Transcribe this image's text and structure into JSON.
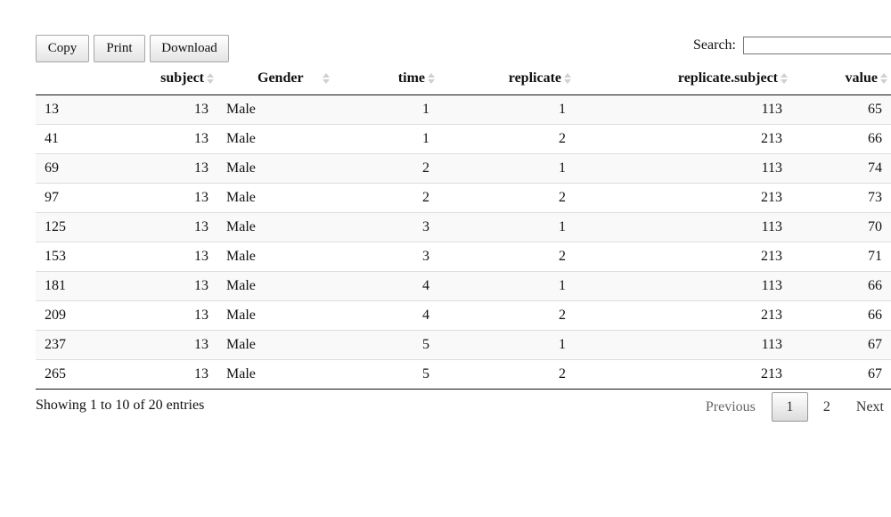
{
  "toolbar": {
    "copy_label": "Copy",
    "print_label": "Print",
    "download_label": "Download"
  },
  "search": {
    "label": "Search:",
    "value": ""
  },
  "table": {
    "columns": [
      "",
      "subject",
      "Gender",
      "time",
      "replicate",
      "replicate.subject",
      "value"
    ],
    "rows": [
      [
        "13",
        "13",
        "Male",
        "1",
        "1",
        "113",
        "65"
      ],
      [
        "41",
        "13",
        "Male",
        "1",
        "2",
        "213",
        "66"
      ],
      [
        "69",
        "13",
        "Male",
        "2",
        "1",
        "113",
        "74"
      ],
      [
        "97",
        "13",
        "Male",
        "2",
        "2",
        "213",
        "73"
      ],
      [
        "125",
        "13",
        "Male",
        "3",
        "1",
        "113",
        "70"
      ],
      [
        "153",
        "13",
        "Male",
        "3",
        "2",
        "213",
        "71"
      ],
      [
        "181",
        "13",
        "Male",
        "4",
        "1",
        "113",
        "66"
      ],
      [
        "209",
        "13",
        "Male",
        "4",
        "2",
        "213",
        "66"
      ],
      [
        "237",
        "13",
        "Male",
        "5",
        "1",
        "113",
        "67"
      ],
      [
        "265",
        "13",
        "Male",
        "5",
        "2",
        "213",
        "67"
      ]
    ]
  },
  "info": "Showing 1 to 10 of 20 entries",
  "pagination": {
    "previous": "Previous",
    "pages": [
      "1",
      "2"
    ],
    "current": "1",
    "next": "Next"
  }
}
